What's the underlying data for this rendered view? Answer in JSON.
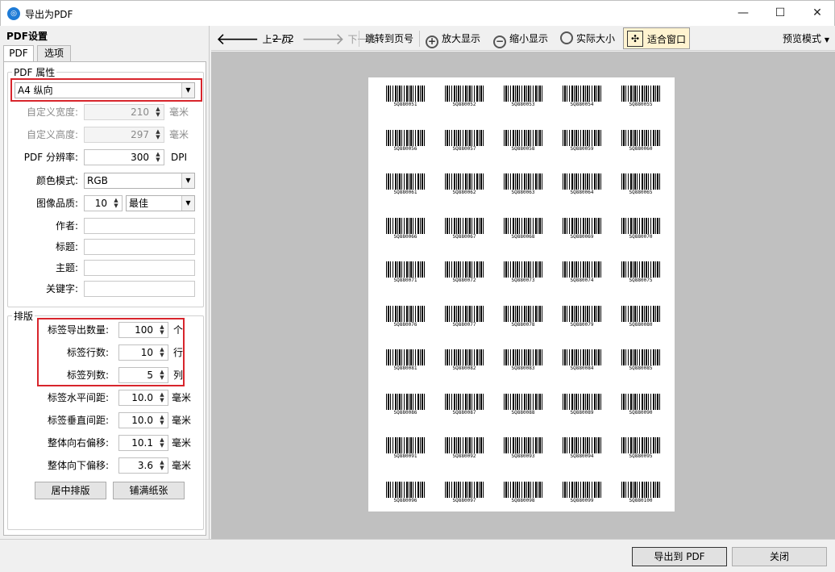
{
  "window": {
    "title": "导出为PDF",
    "app_icon": "pdf-app-icon",
    "minimize": "—",
    "maximize": "☐",
    "close": "✕"
  },
  "settings": {
    "title": "PDF设置",
    "tabs": [
      {
        "label": "PDF",
        "active": true
      },
      {
        "label": "选项",
        "active": false
      }
    ],
    "pdf_props": {
      "group_title": "PDF 属性",
      "paper": "A4 纵向",
      "custom_width": {
        "label": "自定义宽度:",
        "value": "210",
        "unit": "毫米"
      },
      "custom_height": {
        "label": "自定义高度:",
        "value": "297",
        "unit": "毫米"
      },
      "resolution": {
        "label": "PDF 分辨率:",
        "value": "300",
        "unit": "DPI"
      },
      "color_mode": {
        "label": "颜色模式:",
        "value": "RGB"
      },
      "quality": {
        "label": "图像品质:",
        "value": "10",
        "preset": "最佳"
      },
      "author": {
        "label": "作者:",
        "value": ""
      },
      "title_field": {
        "label": "标题:",
        "value": ""
      },
      "subject": {
        "label": "主题:",
        "value": ""
      },
      "keywords": {
        "label": "关键字:",
        "value": ""
      }
    },
    "layout": {
      "group_title": "排版",
      "count": {
        "label": "标签导出数量:",
        "value": "100",
        "unit": "个"
      },
      "rows": {
        "label": "标签行数:",
        "value": "10",
        "unit": "行"
      },
      "cols": {
        "label": "标签列数:",
        "value": "5",
        "unit": "列"
      },
      "hgap": {
        "label": "标签水平间距:",
        "value": "10.0",
        "unit": "毫米"
      },
      "vgap": {
        "label": "标签垂直间距:",
        "value": "10.0",
        "unit": "毫米"
      },
      "xoff": {
        "label": "整体向右偏移:",
        "value": "10.1",
        "unit": "毫米"
      },
      "yoff": {
        "label": "整体向下偏移:",
        "value": "3.6",
        "unit": "毫米"
      },
      "center_btn": "居中排版",
      "fill_btn": "铺满纸张"
    }
  },
  "toolbar": {
    "prev": "上一页",
    "page_indicator": "2 / 2",
    "next": "下一页",
    "goto": "跳转到页号",
    "zoom_in": "放大显示",
    "zoom_out": "缩小显示",
    "actual": "实际大小",
    "fit": "适合窗口",
    "preview_mode": "预览模式"
  },
  "labels": [
    "SQ880051",
    "SQ880052",
    "SQ880053",
    "SQ880054",
    "SQ880055",
    "SQ880056",
    "SQ880057",
    "SQ880058",
    "SQ880059",
    "SQ880060",
    "SQ880061",
    "SQ880062",
    "SQ880063",
    "SQ880064",
    "SQ880065",
    "SQ880066",
    "SQ880067",
    "SQ880068",
    "SQ880069",
    "SQ880070",
    "SQ880071",
    "SQ880072",
    "SQ880073",
    "SQ880074",
    "SQ880075",
    "SQ880076",
    "SQ880077",
    "SQ880078",
    "SQ880079",
    "SQ880080",
    "SQ880081",
    "SQ880082",
    "SQ880083",
    "SQ880084",
    "SQ880085",
    "SQ880086",
    "SQ880087",
    "SQ880088",
    "SQ880089",
    "SQ880090",
    "SQ880091",
    "SQ880092",
    "SQ880093",
    "SQ880094",
    "SQ880095",
    "SQ880096",
    "SQ880097",
    "SQ880098",
    "SQ880099",
    "SQ880100"
  ],
  "footer": {
    "export": "导出到 PDF",
    "close": "关闭"
  }
}
